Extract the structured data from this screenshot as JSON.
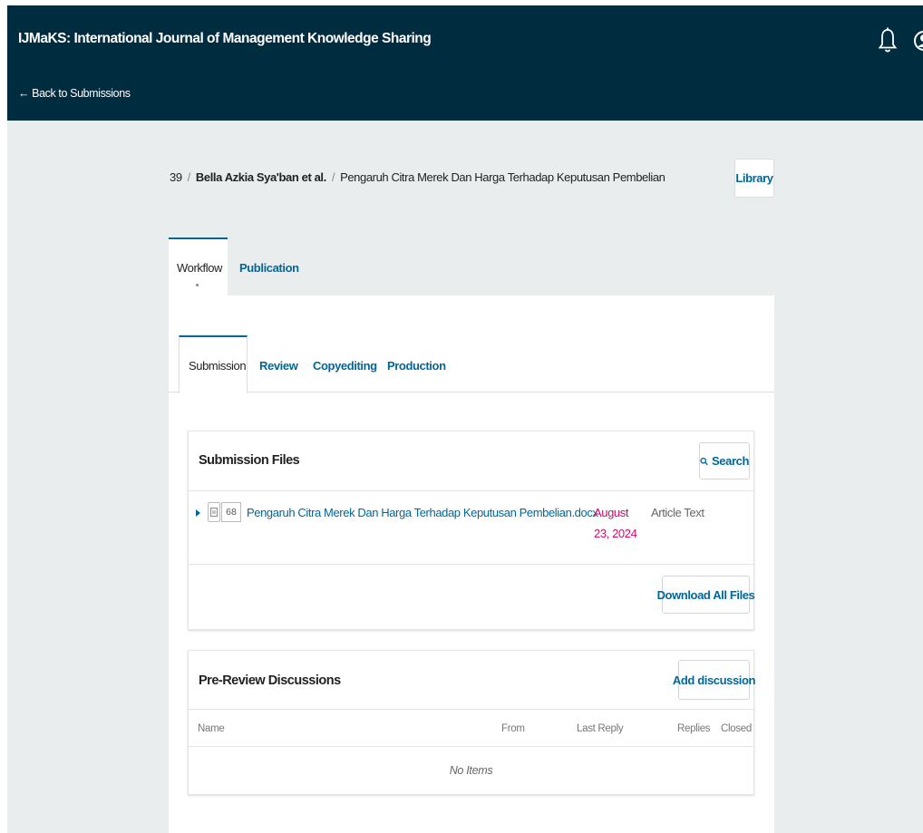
{
  "header": {
    "journal_title": "IJMaKS: International Journal of Management Knowledge Sharing",
    "back_link": "← Back to Submissions",
    "brand_color": "#002c40"
  },
  "breadcrumb": {
    "id": "39",
    "separator": "/",
    "authors": "Bella Azkia Sya'ban et al.",
    "title": "Pengaruh Citra Merek Dan Harga Terhadap Keputusan Pembelian"
  },
  "library_button": "Library",
  "main_tabs": [
    {
      "label": "Workflow",
      "active": true
    },
    {
      "label": "Publication",
      "active": false
    }
  ],
  "workflow_tabs": [
    {
      "label": "Submission",
      "active": true
    },
    {
      "label": "Review",
      "active": false
    },
    {
      "label": "Copyediting",
      "active": false
    },
    {
      "label": "Production",
      "active": false
    }
  ],
  "submission_files": {
    "title": "Submission Files",
    "search_label": "Search",
    "files": [
      {
        "id": "68",
        "name": "Pengaruh Citra Merek Dan Harga Terhadap Keputusan Pembelian.docx",
        "date_line1": "August",
        "date_line2": "23, 2024",
        "type": "Article Text"
      }
    ],
    "download_all_label": "Download All Files"
  },
  "discussions": {
    "title": "Pre-Review Discussions",
    "add_label": "Add discussion",
    "columns": [
      "Name",
      "From",
      "Last Reply",
      "Replies",
      "Closed"
    ],
    "empty_text": "No Items"
  },
  "colors": {
    "accent": "#006798",
    "date": "#d00a6c",
    "background": "#eaedee"
  }
}
